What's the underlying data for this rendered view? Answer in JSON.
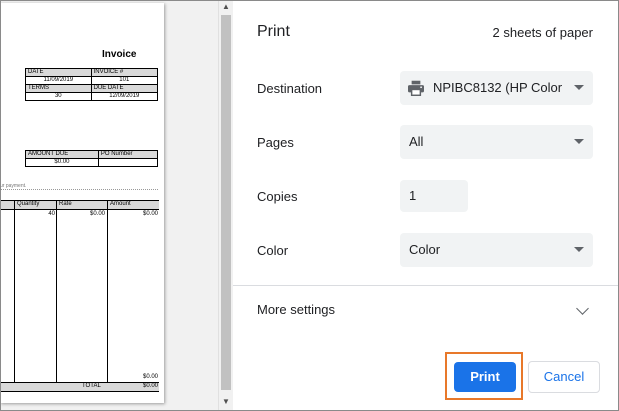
{
  "dialog": {
    "title": "Print",
    "sheets": "2 sheets of paper",
    "destination": {
      "label": "Destination",
      "value": "NPIBC8132 (HP Color",
      "icon": "printer-icon"
    },
    "pages": {
      "label": "Pages",
      "value": "All"
    },
    "copies": {
      "label": "Copies",
      "value": "1"
    },
    "color": {
      "label": "Color",
      "value": "Color"
    },
    "more_settings": "More settings",
    "print_button": "Print",
    "cancel_button": "Cancel",
    "accent_color": "#1a73e8",
    "highlight_color": "#e8782a"
  },
  "preview": {
    "invoice_title": "Invoice",
    "table1": [
      [
        "DATE",
        "INVOICE #"
      ],
      [
        "11/09/2019",
        "101"
      ],
      [
        "TERMS",
        "DUE DATE"
      ],
      [
        "30",
        "12/09/2019"
      ]
    ],
    "table2": [
      [
        "AMOUNT DUE",
        "PO Number"
      ],
      [
        "$0.00",
        ""
      ]
    ],
    "payment_text": "ur payment.",
    "items_headers": [
      "Quantity",
      "Rate",
      "Amount"
    ],
    "item_row": {
      "quantity": "40",
      "rate": "$0.00",
      "amount": "$0.00"
    },
    "subtotal": "$0.00",
    "total_label": "TOTAL",
    "total_value": "$0.00"
  }
}
